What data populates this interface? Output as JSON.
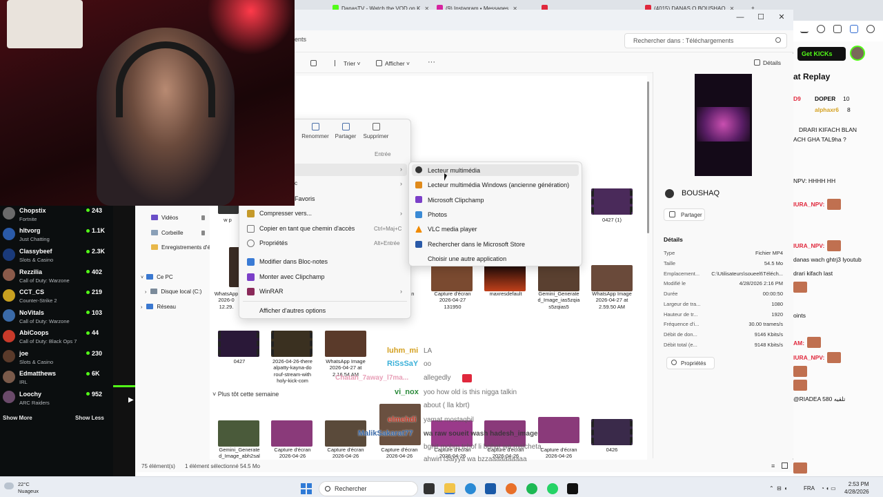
{
  "browser": {
    "tabs": [
      {
        "label": "DanasTV - Watch the VOD on K",
        "color": "#53fc18"
      },
      {
        "label": "(9) Instagram • Messages",
        "color": "#d6249f"
      },
      {
        "label": "…",
        "color": "#e0283c"
      },
      {
        "label": "(4015) DANAS O BOUSHAQ",
        "color": "#e0283c"
      }
    ],
    "get_kicks": "Get KICKs",
    "replay_title": "at Replay",
    "side_chat": [
      {
        "text": "D9",
        "kind": "name"
      },
      {
        "text": "DOPER",
        "kind": "text"
      },
      {
        "text": "10",
        "kind": "text"
      },
      {
        "text": "alphaxr6",
        "kind": "name"
      },
      {
        "text": "8",
        "kind": "text"
      },
      {
        "text": "DRARI KIFACH BLAN",
        "kind": "text"
      },
      {
        "text": "ACH GHA TAL9ha ?",
        "kind": "text"
      },
      {
        "text": "NPV: HHHH HH",
        "kind": "text"
      },
      {
        "text": "IURA_NPV:",
        "kind": "name"
      },
      {
        "text": "IURA_NPV:",
        "kind": "name"
      },
      {
        "text": "danas wach ghtrj3 lyoutub",
        "kind": "text"
      },
      {
        "text": "drari kifach last",
        "kind": "text"
      },
      {
        "text": "oints",
        "kind": "text"
      },
      {
        "text": "AM:",
        "kind": "name"
      },
      {
        "text": "IURA_NPV:",
        "kind": "name"
      },
      {
        "text": "@RIADEA 580 تلقيه",
        "kind": "text"
      }
    ]
  },
  "explorer": {
    "address": "ents",
    "search_placeholder": "Rechercher dans : Téléchargements",
    "commands": {
      "sort": "Trier",
      "view": "Afficher",
      "more": "···",
      "details": "Détails"
    },
    "nav": [
      {
        "label": "Vidéos",
        "color": "#6b4fc8",
        "pinned": true
      },
      {
        "label": "Corbeille",
        "color": "#8aa0b8",
        "pinned": true
      },
      {
        "label": "Enregistrements d'é",
        "color": "#e8b84a",
        "pinned": true
      },
      {
        "label": "Ce PC",
        "color": "#3a78d0",
        "pinned": false
      },
      {
        "label": "Disque local (C:)",
        "color": "#7a8a9a",
        "pinned": false
      },
      {
        "label": "Réseau",
        "color": "#3a78d0",
        "pinned": false
      }
    ],
    "files_row1": [
      {
        "label": "WhatsApp\n2026-0\n12.29.",
        "tone": "#3a2c24",
        "video": false
      },
      {
        "label": "Capture d'écran\n2026-04-27\n131950",
        "tone": "#7a4a30",
        "video": false
      },
      {
        "label": "maxresdefault",
        "tone": "#c0401a",
        "video": false
      },
      {
        "label": "Gemini_Generate\nd_Image_ias5zqia\ns5zqias5",
        "tone": "#5a4030",
        "video": false
      },
      {
        "label": "WhatsApp Image\n2026-04-27 at\n2.59.50 AM",
        "tone": "#6a4a3a",
        "video": false
      }
    ],
    "files_row2": [
      {
        "label": "0427",
        "tone": "#2a1838",
        "video": true
      },
      {
        "label": "2026-04-26-there\nalpatty-kayna-do\nrouf-stream-with\nholy-kick-com",
        "tone": "#3a3020",
        "video": true
      },
      {
        "label": "WhatsApp Image\n2026-04-27 at\n2.16.54 AM",
        "tone": "#5a3a2a",
        "video": false
      }
    ],
    "file_0427_1": "0427 (1)",
    "partial_file": "w p",
    "section": "Plus tôt cette semaine",
    "files_row3": [
      {
        "label": "Gemini_Generate\nd_Image_abh2sal",
        "tone": "#4a5a3a",
        "video": false
      },
      {
        "label": "Capture d'écran\n2026-04-26",
        "tone": "#8a3a7a",
        "video": false
      },
      {
        "label": "Capture d'écran\n2026-04-26",
        "tone": "#5a4a3a",
        "video": false
      },
      {
        "label": "Capture d'écran\n2026-04-26",
        "tone": "#6a5040",
        "video": false
      },
      {
        "label": "Capture d'écran\n2026-04-26",
        "tone": "#9a3a8a",
        "video": false
      },
      {
        "label": "Capture d'écran\n2026-04-26",
        "tone": "#8a3a7a",
        "video": false
      },
      {
        "label": "Capture d'écran\n2026-04-26",
        "tone": "#8a3a7a",
        "video": false
      },
      {
        "label": "0426",
        "tone": "#3a2a4a",
        "video": true
      }
    ],
    "status": {
      "count": "75 élément(s)",
      "selection": "1 élément sélectionné  54.5 Mo"
    }
  },
  "context_menu": {
    "top_actions": [
      {
        "label": "Renommer"
      },
      {
        "label": "Partager"
      },
      {
        "label": "Supprimer"
      }
    ],
    "enter_label": "Entrée",
    "partial_c": "c",
    "favorites": "Favoris",
    "items": [
      {
        "label": "Compresser vers...",
        "icon_color": "#c59a2a",
        "shortcut": "",
        "submenu": true
      },
      {
        "label": "Copier en tant que chemin d'accès",
        "icon_color": "#777777",
        "shortcut": "Ctrl+Maj+C",
        "submenu": false
      },
      {
        "label": "Propriétés",
        "icon_color": "#777777",
        "shortcut": "Alt+Entrée",
        "submenu": false
      },
      {
        "label": "Modifier dans Bloc-notes",
        "icon_color": "#3a7bd5",
        "shortcut": "",
        "submenu": false
      },
      {
        "label": "Monter avec Clipchamp",
        "icon_color": "#7b3fc8",
        "shortcut": "",
        "submenu": false
      },
      {
        "label": "WinRAR",
        "icon_color": "#8a2a5a",
        "shortcut": "",
        "submenu": true
      }
    ],
    "more_options": "Afficher d'autres options"
  },
  "open_with": {
    "items": [
      {
        "label": "Lecteur multimédia",
        "icon_color": "#333333"
      },
      {
        "label": "Lecteur multimédia Windows (ancienne génération)",
        "icon_color": "#e08a1a"
      },
      {
        "label": "Microsoft Clipchamp",
        "icon_color": "#7b3fc8"
      },
      {
        "label": "Photos",
        "icon_color": "#3a8ad5"
      },
      {
        "label": "VLC media player",
        "icon_color": "#f08a00"
      },
      {
        "label": "Rechercher dans le Microsoft Store",
        "icon_color": "#2a5aa8"
      },
      {
        "label": "Choisir une autre application",
        "icon_color": ""
      }
    ]
  },
  "details_pane": {
    "title": "BOUSHAQ",
    "share": "Partager",
    "section": "Détails",
    "props": [
      {
        "key": "Type",
        "value": "Fichier MP4"
      },
      {
        "key": "Taille",
        "value": "54.5 Mo"
      },
      {
        "key": "Emplacement...",
        "value": "C:\\Utilisateurs\\soueelt\\Téléch..."
      },
      {
        "key": "Modifié le",
        "value": "4/28/2026 2:16 PM"
      },
      {
        "key": "Durée",
        "value": "00:00:50"
      },
      {
        "key": "Largeur de tra...",
        "value": "1080"
      },
      {
        "key": "Hauteur de tr...",
        "value": "1920"
      },
      {
        "key": "Fréquence d'i...",
        "value": "30.00 trames/s"
      },
      {
        "key": "Débit de don...",
        "value": "9146 Kbits/s"
      },
      {
        "key": "Débit total (e...",
        "value": "9148 Kbits/s"
      }
    ],
    "properties_btn": "Propriétés"
  },
  "kick_sidebar": {
    "channels": [
      {
        "name": "Chopstix",
        "game": "Fortnite",
        "viewers": "243",
        "color": "#6a6a6a"
      },
      {
        "name": "hltvorg",
        "game": "Just Chatting",
        "viewers": "1.1K",
        "color": "#2a5aa8"
      },
      {
        "name": "Classybeef",
        "game": "Slots & Casino",
        "viewers": "2.3K",
        "color": "#1a3a7a"
      },
      {
        "name": "Rezzilia",
        "game": "Call of Duty: Warzone",
        "viewers": "402",
        "color": "#8a5a4a"
      },
      {
        "name": "CCT_CS",
        "game": "Counter-Strike 2",
        "viewers": "219",
        "color": "#c8a020"
      },
      {
        "name": "NoVitals",
        "game": "Call of Duty: Warzone",
        "viewers": "103",
        "color": "#3a6aa8"
      },
      {
        "name": "AbiCoops",
        "game": "Call of Duty: Black Ops 7",
        "viewers": "44",
        "color": "#c83a2a"
      },
      {
        "name": "joe",
        "game": "Slots & Casino",
        "viewers": "230",
        "color": "#5a3a2a"
      },
      {
        "name": "Edmatthews",
        "game": "IRL",
        "viewers": "6K",
        "color": "#7a5a4a"
      },
      {
        "name": "Loochy",
        "game": "ARC Raiders",
        "viewers": "952",
        "color": "#6a4a6a"
      }
    ],
    "show_more": "Show More",
    "show_less": "Show Less"
  },
  "chat_overlay": [
    {
      "user": "luhm_mi",
      "msg": "LA",
      "color": "#d4a020"
    },
    {
      "user": "RiSsSaY",
      "msg": "oo",
      "color": "#3ab0d8"
    },
    {
      "user": "Chatah_7away_l7ma...",
      "msg": "allegedly",
      "color": "#e8a0b8"
    },
    {
      "user": "vi_nox",
      "msg": "yoo how old is this nigga talkin",
      "color": "#2a8a3a"
    },
    {
      "user": "",
      "msg": "about ( lla kbrt)",
      "color": "#5a5a5a"
    },
    {
      "user": "elmehdi",
      "msg": "yamat mostaqbil",
      "color": "#c83a2a"
    },
    {
      "user": "MalikSakarat77",
      "msg": "wa raw soueit wash hadesh_image",
      "color": "#3a6aa8"
    },
    {
      "user": "",
      "msg": "bghit mohm tchof li bghat wa malcheta",
      "color": "#5a5a5a"
    },
    {
      "user": "",
      "msg": "ahwin l3alyya wa bzzaaaaaaaaaa",
      "color": "#5a5a5a"
    }
  ],
  "taskbar": {
    "weather_temp": "22°C",
    "weather_desc": "Nuageux",
    "search": "Rechercher",
    "lang": "FRA",
    "time": "2:53 PM",
    "date": "4/28/2026"
  }
}
